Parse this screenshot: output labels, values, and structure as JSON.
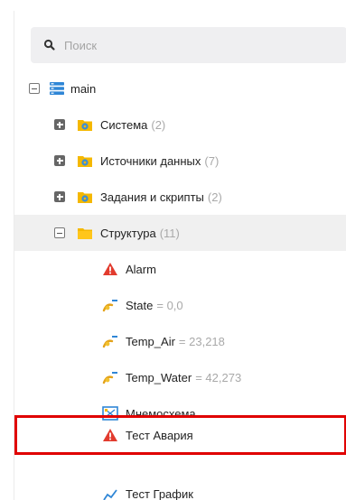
{
  "search": {
    "placeholder": "Поиск",
    "icon": "search-icon"
  },
  "tree": {
    "root": {
      "label": "main",
      "icon": "database-icon",
      "state": "expanded"
    },
    "folders": [
      {
        "label": "Система",
        "count": "(2)",
        "state": "collapsed",
        "icon": "folder-gear-icon"
      },
      {
        "label": "Источники данных",
        "count": "(7)",
        "state": "collapsed",
        "icon": "folder-gear-icon"
      },
      {
        "label": "Задания и скрипты",
        "count": "(2)",
        "state": "collapsed",
        "icon": "folder-gear-icon"
      },
      {
        "label": "Структура",
        "count": "(11)",
        "state": "expanded",
        "icon": "folder-icon"
      }
    ],
    "children": [
      {
        "label": "Alarm",
        "value": "",
        "icon": "alarm-triangle-icon"
      },
      {
        "label": "State",
        "value": "= 0,0",
        "icon": "variable-icon"
      },
      {
        "label": "Temp_Air",
        "value": "= 23,218",
        "icon": "variable-icon"
      },
      {
        "label": "Temp_Water",
        "value": "= 42,273",
        "icon": "variable-icon"
      },
      {
        "label": "Мнемосхема",
        "value": "",
        "icon": "scheme-icon"
      },
      {
        "label": "Тест Авария",
        "value": "",
        "icon": "alarm-triangle-icon"
      },
      {
        "label": "Тест График",
        "value": "",
        "icon": "chart-icon"
      }
    ]
  },
  "colors": {
    "alarm": "#e23b2e",
    "folder": "#f5b800",
    "gear": "#3b8ed8",
    "highlight": "#e00000",
    "selected_bg": "#f0f0f0"
  }
}
